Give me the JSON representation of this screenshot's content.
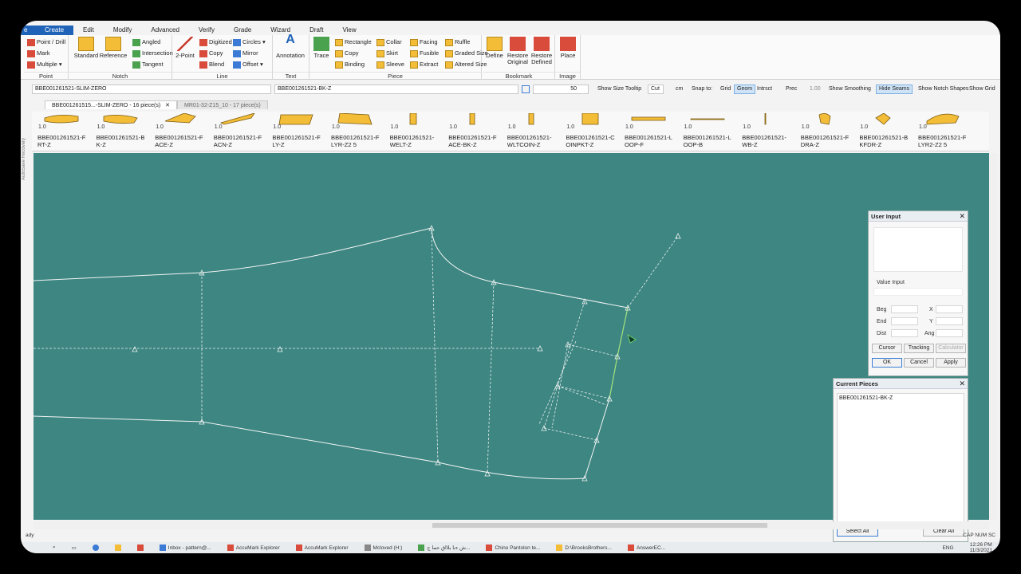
{
  "ribbon": {
    "tabs": [
      {
        "id": "file",
        "label": "e"
      },
      {
        "id": "create",
        "label": "Create"
      },
      {
        "id": "edit",
        "label": "Edit"
      },
      {
        "id": "modify",
        "label": "Modify"
      },
      {
        "id": "advanced",
        "label": "Advanced"
      },
      {
        "id": "verify",
        "label": "Verify"
      },
      {
        "id": "grade",
        "label": "Grade"
      },
      {
        "id": "wizard",
        "label": "Wizard"
      },
      {
        "id": "draft",
        "label": "Draft"
      },
      {
        "id": "view",
        "label": "View"
      }
    ],
    "point": {
      "label": "Point",
      "items": [
        "Point / Drill",
        "Mark",
        "Multiple ▾"
      ]
    },
    "notch": {
      "label": "Notch",
      "standard": "Standard",
      "reference": "Reference",
      "items": [
        "Angled",
        "Intersection",
        "Tangent"
      ]
    },
    "line": {
      "label": "Line",
      "two_point": "2-Point",
      "items": [
        "Digitized",
        "Copy",
        "Blend",
        "Circles ▾",
        "Mirror",
        "Offset ▾"
      ]
    },
    "text": {
      "label": "Text",
      "annotation": "Annotation"
    },
    "piece": {
      "label": "Piece",
      "trace": "Trace",
      "items": [
        "Rectangle",
        "Copy",
        "Binding",
        "Collar",
        "Skirt",
        "Sleeve",
        "Facing",
        "Fusible",
        "Extract",
        "Ruffle",
        "Graded Size",
        "Altered Size"
      ]
    },
    "bookmark": {
      "label": "Bookmark",
      "define": "Define",
      "restore_original": "Restore Original",
      "restore_defined": "Restore Defined"
    },
    "image": {
      "label": "Image",
      "place": "Place"
    }
  },
  "toolbar": {
    "style_field": "BBE001261521-SLIM-ZERO",
    "piece_field": "BBE001261521-BK-Z",
    "zoom_value": "50",
    "show_size_tooltip": "Show Size Tooltip",
    "cut": "Cut",
    "units": "cm",
    "snap_to": "Snap to:",
    "grid": "Grid",
    "geom": "Geom",
    "intrsct": "Intrsct",
    "prec": "Prec",
    "prec_value": "1.00",
    "show_smoothing": "Show Smoothing",
    "hide_seams": "Hide Seams",
    "show_notch_shapes": "Show Notch Shapes",
    "show_grid": "Show Grid"
  },
  "doc_tabs": [
    {
      "label": "BBE001261515...-SLIM-ZERO - 16 piece(s)",
      "close": "✕"
    },
    {
      "label": "MR01-32-Z15_10 - 17 piece(s)"
    }
  ],
  "side_label": "AutoSave Recovery",
  "pieces": [
    {
      "scale": "1.0",
      "name1": "BBE001261521-F",
      "name2": "RT-Z"
    },
    {
      "scale": "1.0",
      "name1": "BBE001261521-B",
      "name2": "K-Z"
    },
    {
      "scale": "1.0",
      "name1": "BBE001261521-F",
      "name2": "ACE-Z"
    },
    {
      "scale": "1.0",
      "name1": "BBE001261521-F",
      "name2": "ACN-Z"
    },
    {
      "scale": "1.0",
      "name1": "BBE001261521-F",
      "name2": "LY-Z"
    },
    {
      "scale": "1.0",
      "name1": "BBE001261521-F",
      "name2": "LYR-Z2 5"
    },
    {
      "scale": "1.0",
      "name1": "BBE001261521-",
      "name2": "WELT-Z"
    },
    {
      "scale": "1.0",
      "name1": "BBE001261521-F",
      "name2": "ACE-BK-Z"
    },
    {
      "scale": "1.0",
      "name1": "BBE001261521-",
      "name2": "WLTCOIN-Z"
    },
    {
      "scale": "1.0",
      "name1": "BBE001261521-C",
      "name2": "OINPKT-Z"
    },
    {
      "scale": "1.0",
      "name1": "BBE001261521-L",
      "name2": "OOP-F"
    },
    {
      "scale": "1.0",
      "name1": "BBE001261521-L",
      "name2": "OOP-B"
    },
    {
      "scale": "1.0",
      "name1": "BBE001261521-",
      "name2": "WB-Z"
    },
    {
      "scale": "1.0",
      "name1": "BBE001261521-F",
      "name2": "DRA-Z"
    },
    {
      "scale": "1.0",
      "name1": "BBE001261521-B",
      "name2": "KFDR-Z"
    },
    {
      "scale": "1.0",
      "name1": "BBE001261521-F",
      "name2": "LYR2-Z2 5"
    }
  ],
  "user_input": {
    "title": "User Input",
    "close": "✕",
    "value_input": "Value Input",
    "beg": "Beg",
    "end": "End",
    "dist": "Dist",
    "x": "X",
    "y": "Y",
    "ang": "Ang",
    "cursor": "Cursor",
    "tracking": "Tracking",
    "calculator": "Calculator",
    "ok": "OK",
    "cancel": "Cancel",
    "apply": "Apply"
  },
  "current_pieces": {
    "title": "Current Pieces",
    "close": "✕",
    "items": [
      "BBE001261521-BK-Z"
    ],
    "select_all": "Select All",
    "clear_all": "Clear All"
  },
  "status": {
    "left": "ady",
    "right": "CAP  NUM  SC"
  },
  "taskbar": {
    "items": [
      "Inbox - pattern@...",
      "AccuMark Explorer",
      "AccuMark Explorer",
      "Mcloved (H:)",
      "ش ءنا بلااق حما ج...",
      "Chino Pantolon te...",
      "D:\\BrooksBrothers...",
      "AnswerEC..."
    ],
    "lang": "ENG",
    "time": "12:26 PM",
    "date": "11/3/2021"
  },
  "colors": {
    "canvas": "#3d8682",
    "accent": "#1e63b8",
    "piece_fill": "#f3bd38",
    "selected_line": "#9be36b"
  }
}
